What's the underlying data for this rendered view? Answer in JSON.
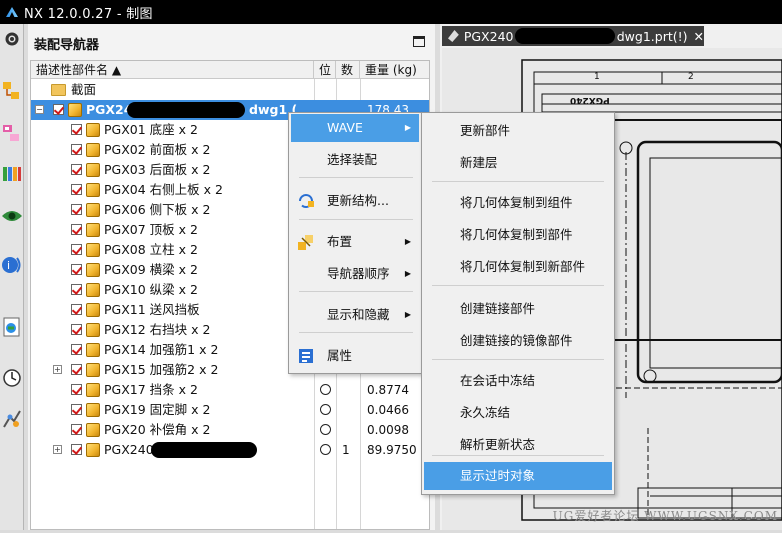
{
  "window": {
    "title": "NX 12.0.0.27 - 制图"
  },
  "panel": {
    "title": "装配导航器",
    "columns": {
      "name": "描述性部件名 ▲",
      "position": "位",
      "quantity": "数",
      "weight": "重量 (kg)"
    },
    "section_row": "截面",
    "root_row": {
      "name_prefix": "PGX24",
      "name_suffix": "dwg1 (",
      "weight": "178.43"
    },
    "rows": [
      {
        "name": "PGX01 底座 x 2"
      },
      {
        "name": "PGX02 前面板 x 2"
      },
      {
        "name": "PGX03 后面板 x 2"
      },
      {
        "name": "PGX04 右侧上板 x 2"
      },
      {
        "name": "PGX06 侧下板 x 2"
      },
      {
        "name": "PGX07 顶板 x 2"
      },
      {
        "name": "PGX08 立柱 x 2"
      },
      {
        "name": "PGX09 横梁 x 2"
      },
      {
        "name": "PGX10 纵梁 x 2"
      },
      {
        "name": "PGX11 送风挡板"
      },
      {
        "name": "PGX12 右挡块 x 2"
      },
      {
        "name": "PGX14 加强筋1 x 2"
      },
      {
        "name": "PGX15 加强筋2 x 2",
        "expandable": true
      },
      {
        "name": "PGX17 挡条 x 2",
        "weight": "0.8774",
        "position_marker": true
      },
      {
        "name": "PGX19 固定脚 x 2",
        "weight": "0.0466",
        "position_marker": true
      },
      {
        "name": "PGX20 补偿角 x 2",
        "weight": "0.0098",
        "position_marker": true
      },
      {
        "name": "PGX240",
        "quantity": "1",
        "weight": "89.9750",
        "position_marker": true,
        "expandable": true
      }
    ]
  },
  "drawing_tab": {
    "label_prefix": "PGX240",
    "label_suffix": "dwg1.prt(!)",
    "close": "✕",
    "title_block_text": "PGX240",
    "zone_1": "1",
    "zone_2": "2"
  },
  "context_menu": {
    "items": [
      {
        "label": "WAVE",
        "submenu": true,
        "highlighted": true
      },
      {
        "label": "选择装配"
      },
      {
        "label": "更新结构...",
        "icon": "update-structure-icon"
      },
      {
        "label": "布置",
        "submenu": true,
        "icon": "arrangement-icon"
      },
      {
        "label": "导航器顺序",
        "submenu": true
      },
      {
        "label": "显示和隐藏",
        "submenu": true
      },
      {
        "label": "属性",
        "icon": "properties-icon"
      }
    ]
  },
  "wave_submenu": {
    "items": [
      "更新部件",
      "新建层",
      "将几何体复制到组件",
      "将几何体复制到部件",
      "将几何体复制到新部件",
      "创建链接部件",
      "创建链接的镜像部件",
      "在会话中冻结",
      "永久冻结",
      "解析更新状态",
      "显示过时对象"
    ],
    "highlighted_index": 10
  },
  "watermark": "UG爱好者论坛 WWW.UGSNX.COM",
  "colors": {
    "selection": "#3c8ee0",
    "menu_highlight": "#4a9ee6",
    "checkbox": "#d01818"
  }
}
